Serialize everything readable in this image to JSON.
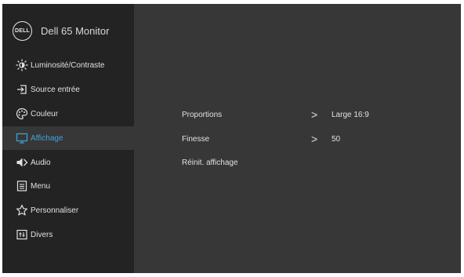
{
  "header": {
    "logo_text": "DELL",
    "title": "Dell 65 Monitor"
  },
  "sidebar": {
    "active_color": "#3fa2dc",
    "items": [
      {
        "label": "Luminosité/Contraste",
        "icon": "brightness-icon"
      },
      {
        "label": "Source entrée",
        "icon": "input-source-icon"
      },
      {
        "label": "Couleur",
        "icon": "palette-icon"
      },
      {
        "label": "Affichage",
        "icon": "display-icon",
        "active": true
      },
      {
        "label": "Audio",
        "icon": "speaker-icon"
      },
      {
        "label": "Menu",
        "icon": "menu-icon"
      },
      {
        "label": "Personnaliser",
        "icon": "star-icon"
      },
      {
        "label": "Divers",
        "icon": "other-settings-icon"
      }
    ]
  },
  "main": {
    "rows": [
      {
        "label": "Proportions",
        "value": "Large 16:9",
        "chevron": ">"
      },
      {
        "label": "Finesse",
        "value": "50",
        "chevron": ">"
      },
      {
        "label": "Réinit. affichage"
      }
    ]
  }
}
